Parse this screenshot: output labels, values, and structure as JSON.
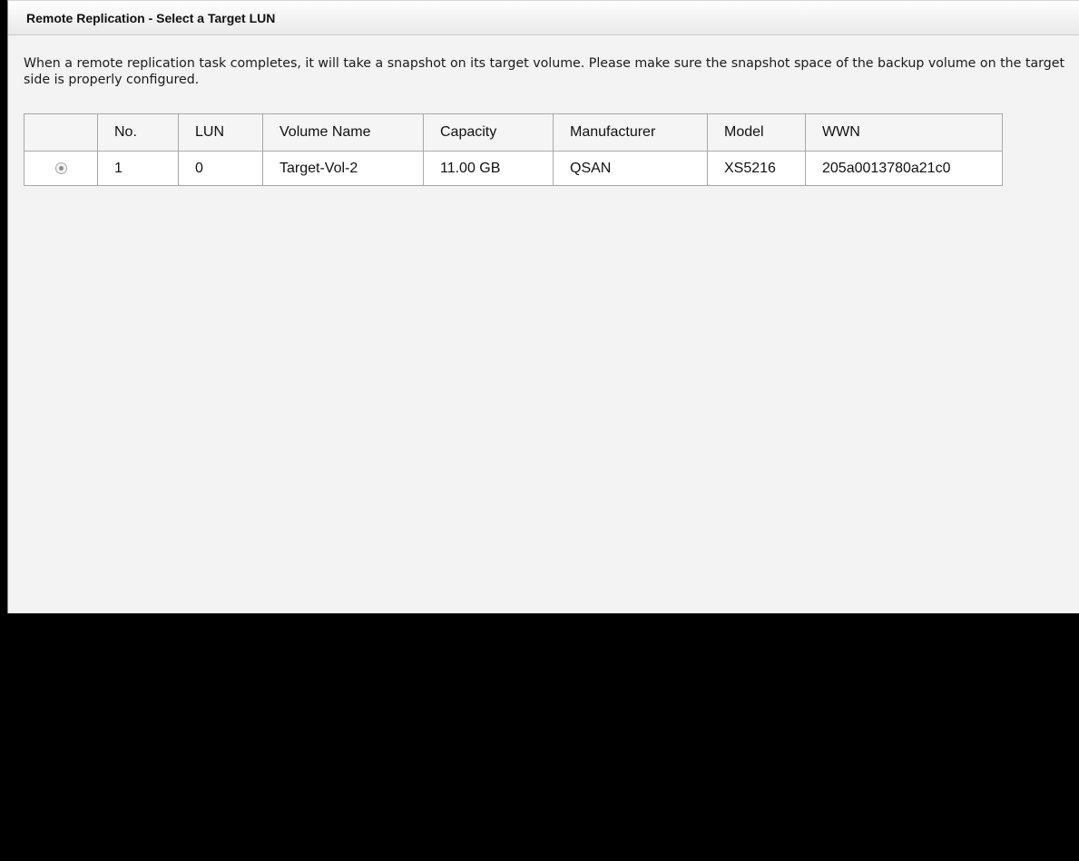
{
  "dialog": {
    "title": "Remote Replication - Select a Target LUN",
    "note": "When a remote replication task completes, it will take a snapshot on its target volume. Please make sure the snapshot space of the backup volume on the target side is properly configured."
  },
  "table": {
    "columns": [
      "",
      "No.",
      "LUN",
      "Volume Name",
      "Capacity",
      "Manufacturer",
      "Model",
      "WWN"
    ],
    "rows": [
      {
        "selected": true,
        "no": "1",
        "lun": "0",
        "volume_name": "Target-Vol-2",
        "capacity": "11.00 GB",
        "manufacturer": "QSAN",
        "model": "XS5216",
        "wwn": "205a0013780a21c0"
      }
    ]
  }
}
